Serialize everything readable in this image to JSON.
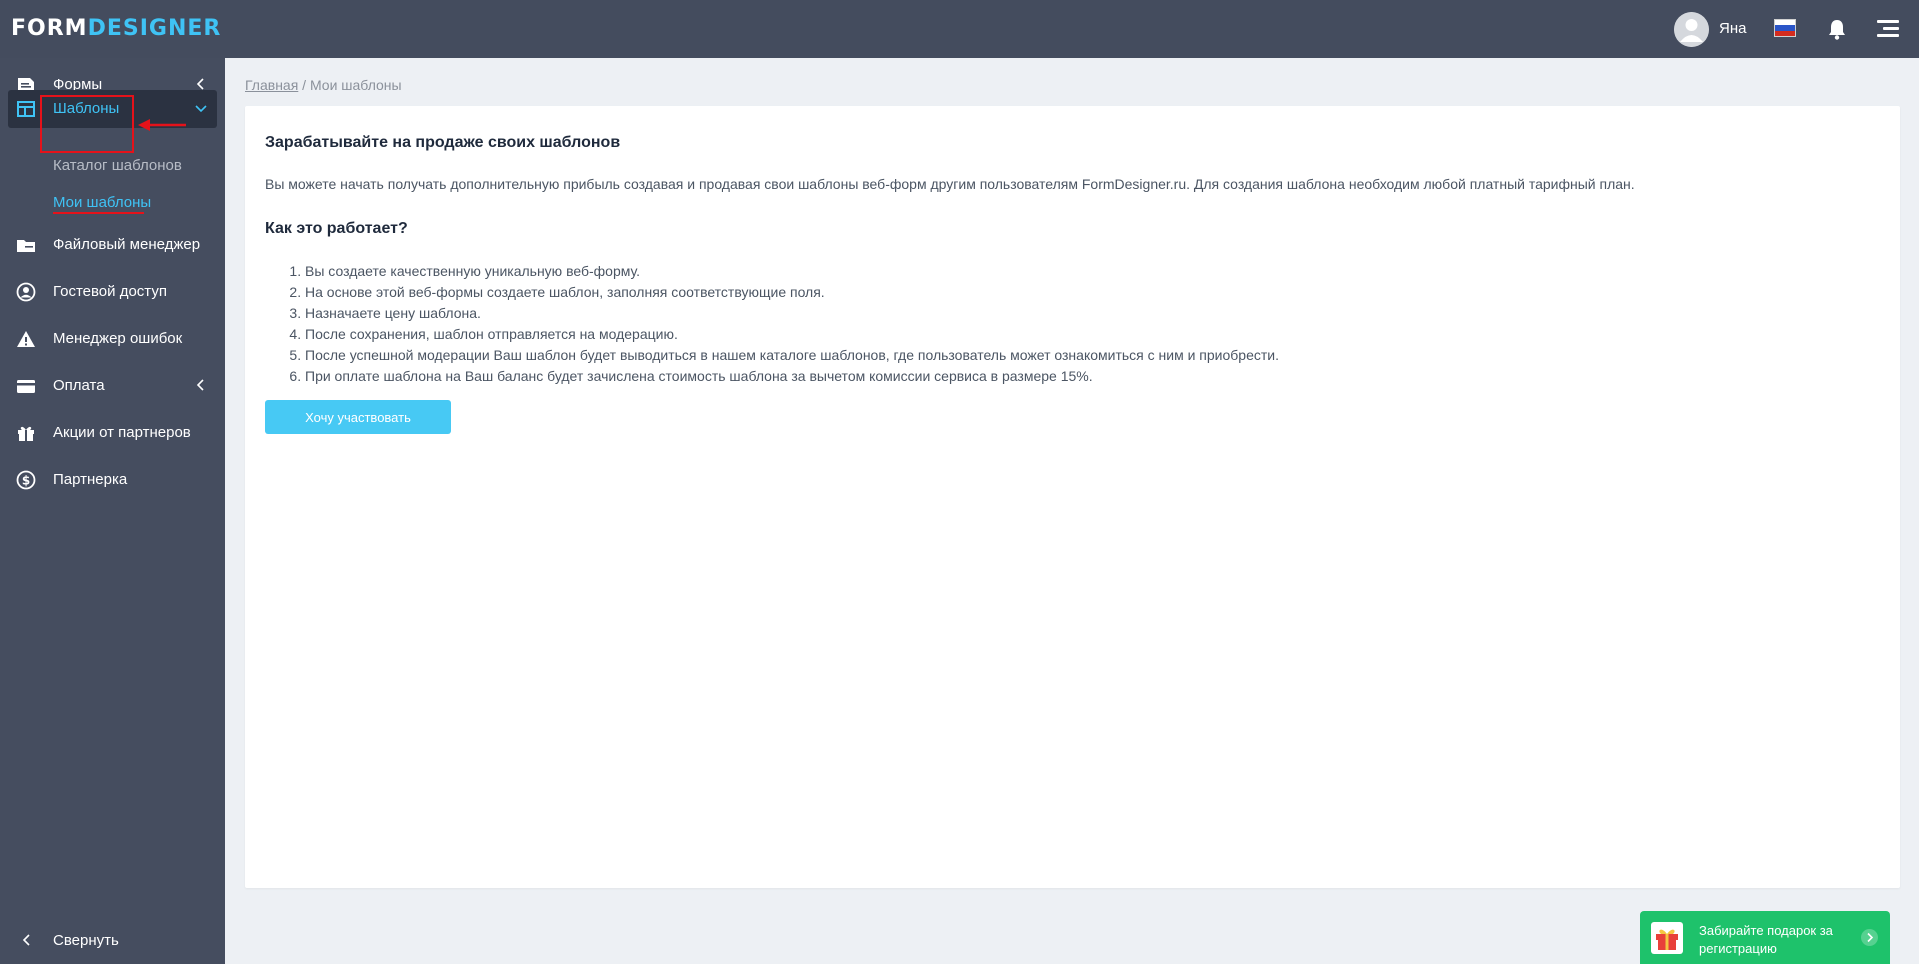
{
  "header": {
    "logo_part1": "FORM",
    "logo_part2": "DESIGNER",
    "username": "Яна"
  },
  "sidebar": {
    "items": [
      {
        "label": "Формы"
      },
      {
        "label": "Шаблоны"
      },
      {
        "label": "Файловый менеджер"
      },
      {
        "label": "Гостевой доступ"
      },
      {
        "label": "Менеджер ошибок"
      },
      {
        "label": "Оплата"
      },
      {
        "label": "Акции от партнеров"
      },
      {
        "label": "Партнерка"
      }
    ],
    "subitems": [
      {
        "label": "Каталог шаблонов"
      },
      {
        "label": "Мои шаблоны"
      }
    ],
    "collapse_label": "Свернуть"
  },
  "breadcrumb": {
    "home": "Главная",
    "separator": " / ",
    "current": "Мои шаблоны"
  },
  "main": {
    "title": "Зарабатывайте на продаже своих шаблонов",
    "intro": "Вы можете начать получать дополнительную прибыль создавая и продавая свои шаблоны веб-форм другим пользователям FormDesigner.ru. Для создания шаблона необходим любой платный тарифный план.",
    "how_title": "Как это работает?",
    "steps": [
      "Вы создаете качественную уникальную веб-форму.",
      "На основе этой веб-формы создаете шаблон, заполняя соответствующие поля.",
      "Назначаете цену шаблона.",
      "После сохранения, шаблон отправляется на модерацию.",
      "После успешной модерации Ваш шаблон будет выводиться в нашем каталоге шаблонов, где пользователь может ознакомиться с ним и приобрести.",
      "При оплате шаблона на Ваш баланс будет зачислена стоимость шаблона за вычетом комиссии сервиса в размере 15%."
    ],
    "cta_label": "Хочу участвовать"
  },
  "promo": {
    "text": "Забирайте подарок за регистрацию"
  },
  "colors": {
    "topbar": "#444c5e",
    "sidebar": "#454d5f",
    "accent": "#3fc3f5",
    "button": "#47c9f4",
    "promo": "#1ec26b",
    "annotation": "#e5121a"
  },
  "icons": {
    "avatar": "user-avatar-icon",
    "flag": "russia-flag-icon",
    "bell": "bell-icon",
    "menu": "hamburger-menu-icon",
    "forms": "form-document-icon",
    "templates": "template-layout-icon",
    "files": "folder-icon",
    "guest": "user-circle-icon",
    "errors": "warning-triangle-icon",
    "payment": "credit-card-icon",
    "promotions": "gift-icon",
    "partner": "dollar-circle-icon"
  }
}
